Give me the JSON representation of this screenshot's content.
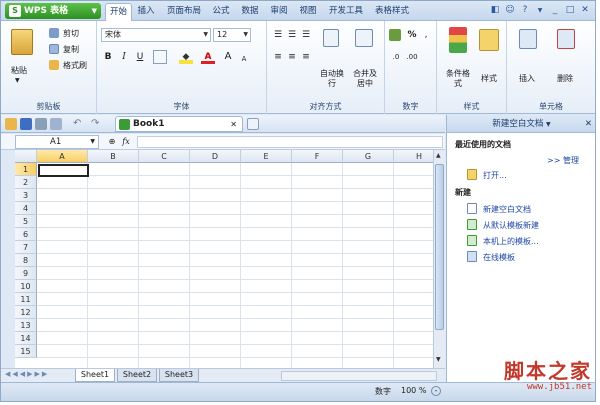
{
  "app": {
    "name": "WPS 表格",
    "logo": "S"
  },
  "tabs": [
    "开始",
    "插入",
    "页面布局",
    "公式",
    "数据",
    "审阅",
    "视图",
    "开发工具",
    "表格样式"
  ],
  "ribbon": {
    "clipboard": {
      "paste": "粘贴",
      "cut": "剪切",
      "copy": "复制",
      "format_painter": "格式刷",
      "group": "剪贴板"
    },
    "font": {
      "name": "宋体",
      "size": "12",
      "bold": "B",
      "italic": "I",
      "underline": "U",
      "grow": "A",
      "shrink": "A",
      "color_a": "A",
      "group": "字体"
    },
    "align": {
      "wrap": "自动换行",
      "merge": "合并及居中",
      "group": "对齐方式"
    },
    "number": {
      "percent": "%",
      "group": "数字"
    },
    "styles": {
      "cond": "条件格式",
      "style": "样式",
      "group": "样式"
    },
    "cells": {
      "insert": "插入",
      "delete": "删除",
      "group": "单元格"
    }
  },
  "book_tab": "Book1",
  "namebox": "A1",
  "columns": [
    "A",
    "B",
    "C",
    "D",
    "E",
    "F",
    "G",
    "H"
  ],
  "rows": [
    "1",
    "2",
    "3",
    "4",
    "5",
    "6",
    "7",
    "8",
    "9",
    "10",
    "11",
    "12",
    "13",
    "14",
    "15"
  ],
  "sheets": [
    "Sheet1",
    "Sheet2",
    "Sheet3"
  ],
  "status": {
    "mode": "数字",
    "zoom": "100 %"
  },
  "pane": {
    "title": "新建空白文档",
    "recent": "最近使用的文档",
    "manage": ">> 管理",
    "open": "打开...",
    "new_header": "新建",
    "items": [
      "新建空白文档",
      "从默认模板新建",
      "本机上的模板...",
      "在线模板"
    ]
  },
  "watermark": {
    "text": "脚本之家",
    "url": "www.jb51.net"
  },
  "colors": {
    "accent": "#2e8f22",
    "link": "#1f47a8",
    "selected_header": "#f7cf66"
  }
}
